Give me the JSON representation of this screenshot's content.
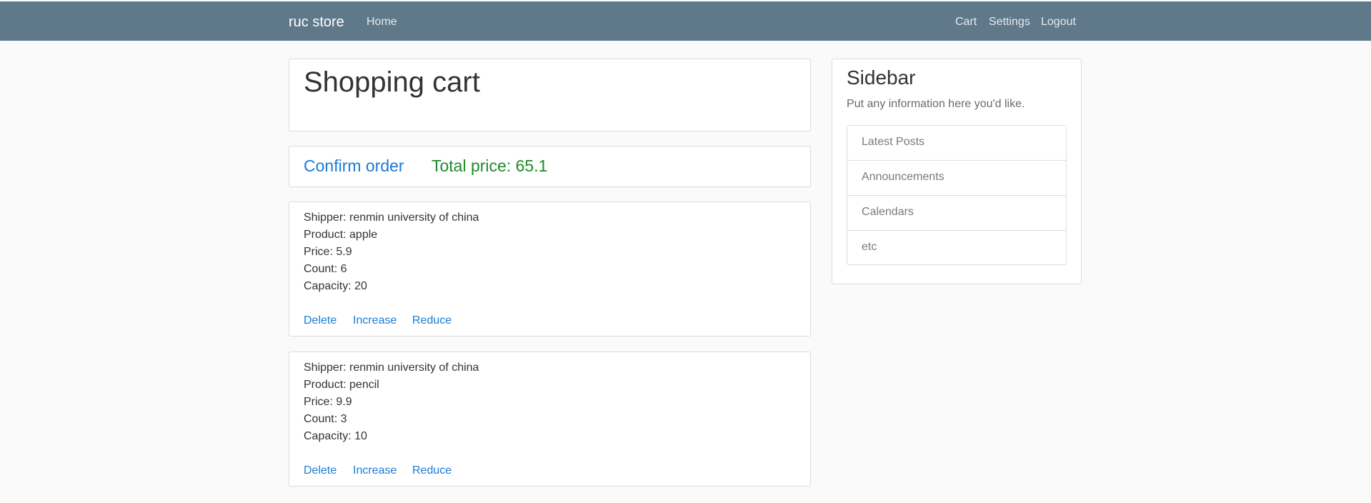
{
  "navbar": {
    "brand": "ruc store",
    "home": "Home",
    "cart": "Cart",
    "settings": "Settings",
    "logout": "Logout"
  },
  "page_title": "Shopping cart",
  "order": {
    "confirm_label": "Confirm order",
    "total_text": "Total price: 65.1"
  },
  "cart_items": [
    {
      "shipper": "Shipper: renmin university of china",
      "product": "Product: apple",
      "price": "Price: 5.9",
      "count": "Count: 6",
      "capacity": "Capacity: 20",
      "delete": "Delete",
      "increase": "Increase",
      "reduce": "Reduce"
    },
    {
      "shipper": "Shipper: renmin university of china",
      "product": "Product: pencil",
      "price": "Price: 9.9",
      "count": "Count: 3",
      "capacity": "Capacity: 10",
      "delete": "Delete",
      "increase": "Increase",
      "reduce": "Reduce"
    }
  ],
  "sidebar": {
    "title": "Sidebar",
    "description": "Put any information here you'd like.",
    "items": [
      "Latest Posts",
      "Announcements",
      "Calendars",
      "etc"
    ]
  },
  "colors": {
    "navbar_bg": "#5f788a",
    "link": "#1a7bd6",
    "total_price": "#1f8a2b"
  }
}
